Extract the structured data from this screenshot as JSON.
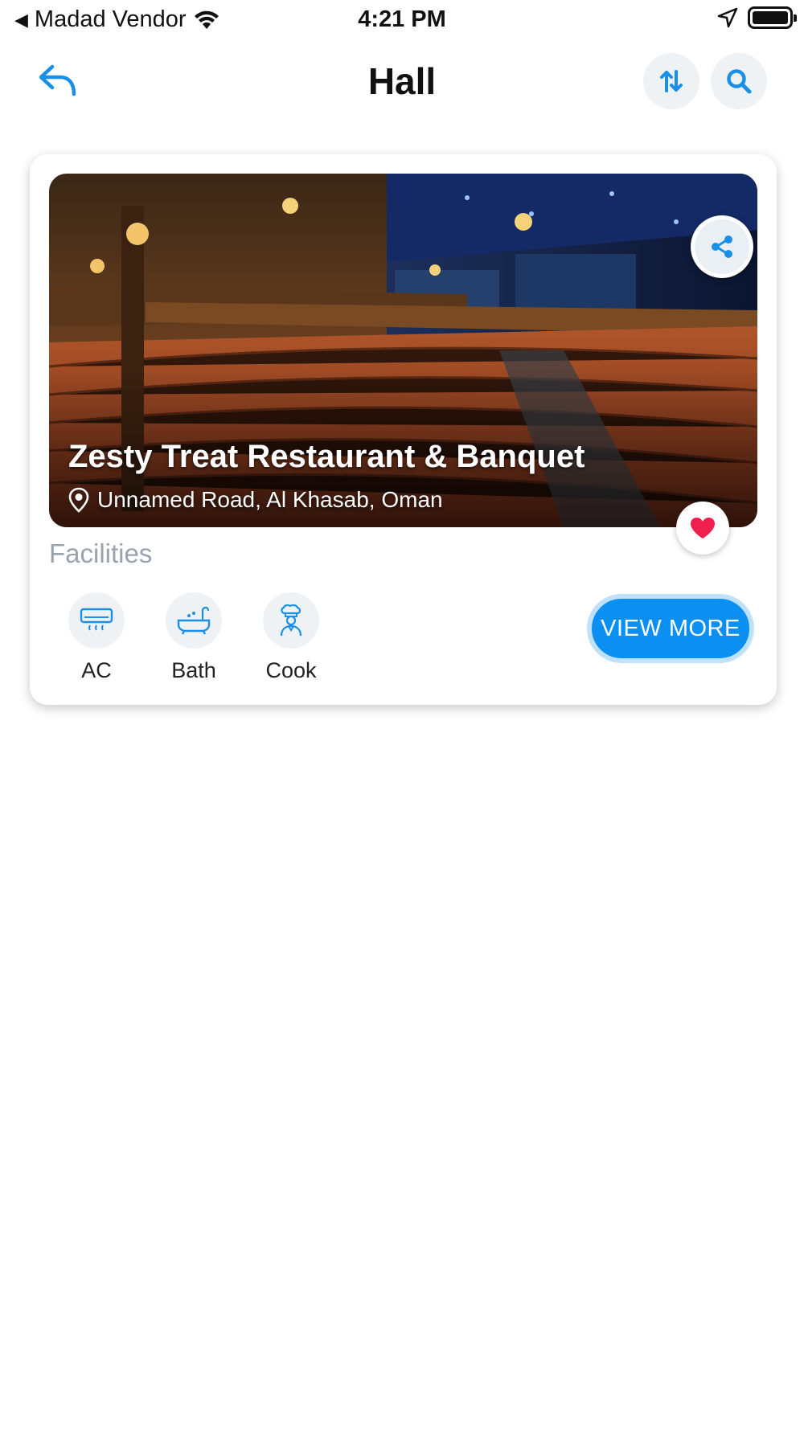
{
  "status_bar": {
    "back_glyph": "◀",
    "carrier": "Madad Vendor",
    "time": "4:21 PM"
  },
  "header": {
    "title": "Hall",
    "back_icon": "reply-arrow-icon",
    "sort_icon": "sort-arrows-icon",
    "search_icon": "search-icon"
  },
  "listing": {
    "name": "Zesty Treat Restaurant & Banquet",
    "address": "Unnamed Road, Al Khasab, Oman",
    "image": "theater-auditorium-photo",
    "is_favorite": true,
    "facilities_title": "Facilities",
    "facilities": [
      {
        "label": "AC",
        "icon": "air-conditioner-icon"
      },
      {
        "label": "Bath",
        "icon": "bathtub-icon"
      },
      {
        "label": "Cook",
        "icon": "chef-icon"
      }
    ],
    "view_more_label": "VIEW MORE"
  },
  "colors": {
    "accent": "#0b8ff0",
    "favorite": "#f0204e",
    "muted_text": "#9aa3ad",
    "icon_bg": "#eef2f5"
  }
}
